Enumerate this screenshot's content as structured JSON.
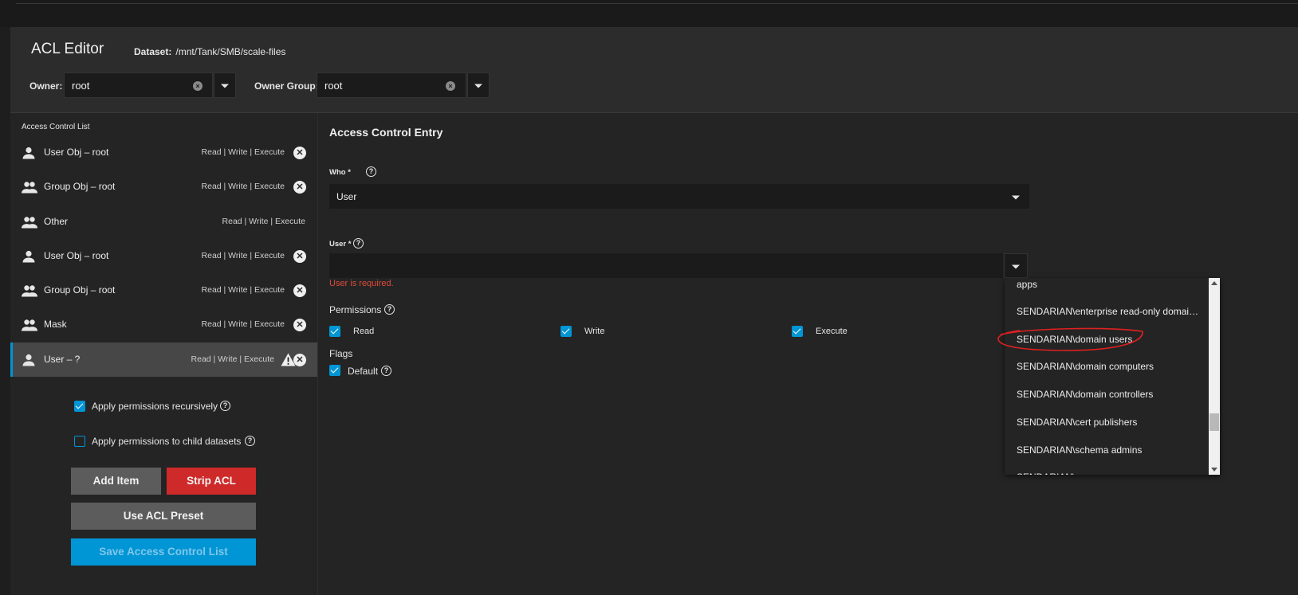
{
  "header": {
    "title": "ACL Editor",
    "dataset_label": "Dataset:",
    "dataset_path": "/mnt/Tank/SMB/scale-files",
    "owner_label": "Owner:",
    "owner_value": "root",
    "owner_group_label": "Owner Group:",
    "owner_group_value": "root"
  },
  "acl": {
    "heading": "Access Control List",
    "items": [
      {
        "name": "User Obj – root",
        "perms": "Read | Write | Execute",
        "icon": "person-icon",
        "removable": true
      },
      {
        "name": "Group Obj – root",
        "perms": "Read | Write | Execute",
        "icon": "group-icon",
        "removable": true
      },
      {
        "name": "Other",
        "perms": "Read | Write | Execute",
        "icon": "group-icon",
        "removable": false
      },
      {
        "name": "User Obj – root",
        "perms": "Read | Write | Execute",
        "icon": "person-icon",
        "removable": true
      },
      {
        "name": "Group Obj – root",
        "perms": "Read | Write | Execute",
        "icon": "group-icon",
        "removable": true
      },
      {
        "name": "Mask",
        "perms": "Read | Write | Execute",
        "icon": "group-icon",
        "removable": true
      },
      {
        "name": "User – ?",
        "perms": "Read | Write | Execute",
        "icon": "person-icon",
        "removable": true,
        "warning": true,
        "selected": true
      }
    ]
  },
  "options": {
    "recursive_label": "Apply permissions recursively",
    "recursive_checked": true,
    "child_label": "Apply permissions to child datasets",
    "child_checked": false
  },
  "buttons": {
    "add_item": "Add Item",
    "strip_acl": "Strip ACL",
    "use_preset": "Use ACL Preset",
    "save": "Save Access Control List"
  },
  "entry": {
    "title": "Access Control Entry",
    "who_label": "Who *",
    "who_value": "User",
    "user_label": "User *",
    "user_value": "",
    "user_error": "User is required.",
    "permissions_label": "Permissions",
    "perm_read": "Read",
    "perm_write": "Write",
    "perm_execute": "Execute",
    "flags_label": "Flags",
    "flag_default": "Default"
  },
  "dropdown": {
    "options": [
      "apps",
      "SENDARIAN\\enterprise read-only domai…",
      "SENDARIAN\\domain users",
      "SENDARIAN\\domain computers",
      "SENDARIAN\\domain controllers",
      "SENDARIAN\\cert publishers",
      "SENDARIAN\\schema admins",
      "SENDARIAN\\..."
    ],
    "highlighted": "SENDARIAN\\domain users"
  },
  "colors": {
    "accent": "#0095d5",
    "danger": "#cf2a2a",
    "error_text": "#e04a3a",
    "annotation": "#e02020"
  }
}
